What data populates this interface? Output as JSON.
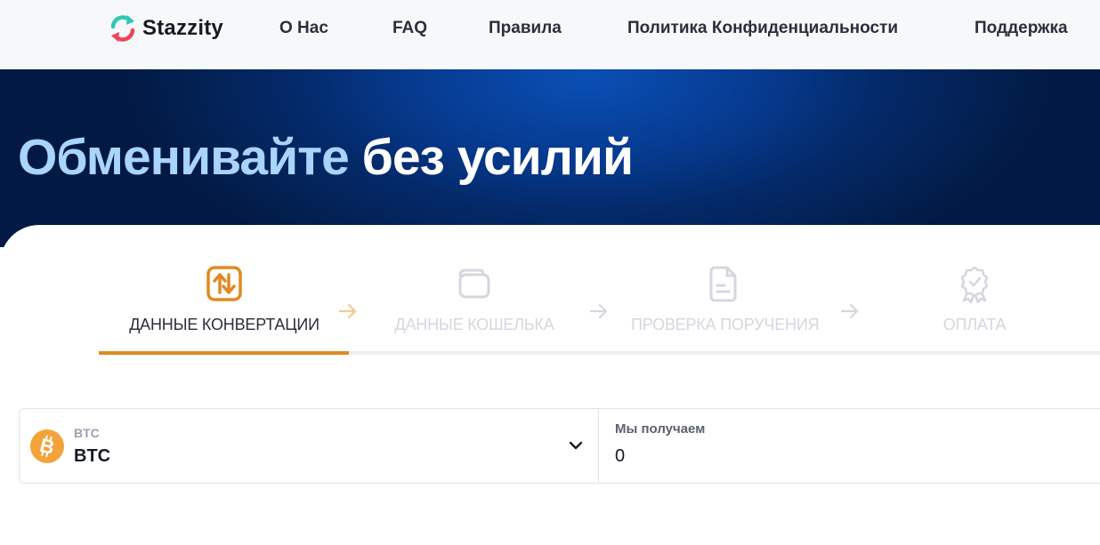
{
  "app": {
    "logo_text": "Stazzity"
  },
  "nav": {
    "links": [
      {
        "label": "О Нас"
      },
      {
        "label": "FAQ"
      },
      {
        "label": "Правила"
      },
      {
        "label": "Политика Конфиденциальности"
      },
      {
        "label": "Поддержка"
      }
    ]
  },
  "hero": {
    "title_accent": "Обменивайте",
    "title_rest": "без усилий"
  },
  "steps": [
    {
      "label": "ДАННЫЕ КОНВЕРТАЦИИ",
      "icon": "exchange-arrows-icon",
      "active": true
    },
    {
      "label": "ДАННЫЕ КОШЕЛЬКА",
      "icon": "wallet-icon",
      "active": false
    },
    {
      "label": "ПРОВЕРКА ПОРУЧЕНИЯ",
      "icon": "document-icon",
      "active": false
    },
    {
      "label": "ОПЛАТА",
      "icon": "award-badge-icon",
      "active": false
    }
  ],
  "progress": {
    "completed_steps": 1,
    "total_steps": 4
  },
  "exchange": {
    "send": {
      "coin_icon": "bitcoin-icon",
      "sublabel": "BTC",
      "value": "BTC"
    },
    "receive": {
      "label": "Мы получаем",
      "value": "0"
    }
  },
  "colors": {
    "accent": "#e08a21",
    "hero_dark": "#021a43",
    "hero_bright": "#0a4fb5",
    "hero_title_accent": "#a9d4ff",
    "bitcoin": "#f2a33a"
  }
}
